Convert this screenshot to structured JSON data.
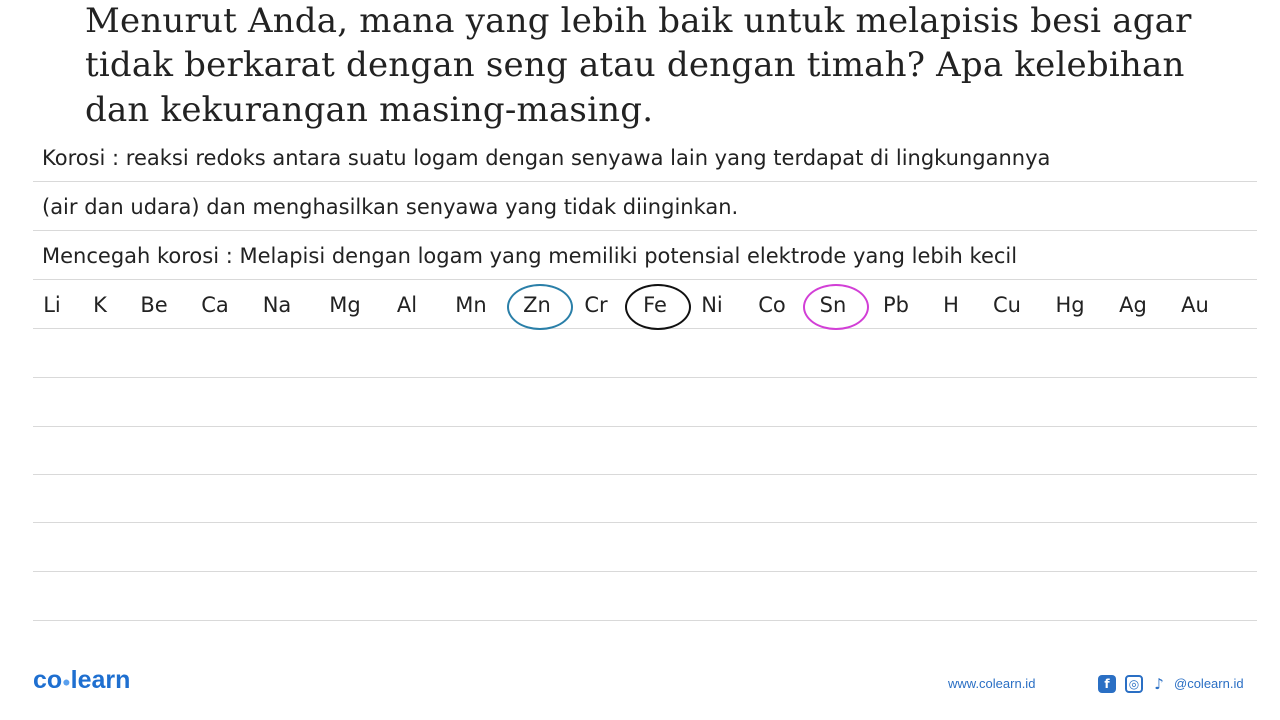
{
  "question": "Menurut Anda, mana yang lebih baik untuk melapisis besi agar tidak berkarat dengan seng atau dengan timah? Apa kelebihan dan kekurangan masing-masing.",
  "question_lines": [
    "Menurut Anda, mana yang lebih baik untuk melapisis besi agar",
    "tidak berkarat dengan seng atau dengan timah? Apa kelebihan",
    "dan kekurangan masing-masing."
  ],
  "answer_lines": [
    "Korosi : reaksi redoks antara suatu logam dengan senyawa lain yang terdapat di lingkungannya",
    "(air dan udara) dan menghasilkan senyawa yang tidak diinginkan.",
    "Mencegah korosi : Melapisi dengan logam yang memiliki potensial elektrode yang lebih kecil"
  ],
  "volta_series": [
    "Li",
    "K",
    "Be",
    "Ca",
    "Na",
    "Mg",
    "Al",
    "Mn",
    "Zn",
    "Cr",
    "Fe",
    "Ni",
    "Co",
    "Sn",
    "Pb",
    "H",
    "Cu",
    "Hg",
    "Ag",
    "Au"
  ],
  "circled": [
    {
      "element": "Zn",
      "color": "#2a7fa8"
    },
    {
      "element": "Fe",
      "color": "#111111"
    },
    {
      "element": "Sn",
      "color": "#d23fd6"
    }
  ],
  "footer": {
    "logo": "co learn",
    "logo_parts": [
      "co",
      "learn"
    ],
    "website": "www.colearn.id",
    "social_handle": "@colearn.id",
    "social_icons": [
      "facebook-icon",
      "instagram-icon",
      "tiktok-icon"
    ],
    "brand_color": "#1e6fd0"
  }
}
